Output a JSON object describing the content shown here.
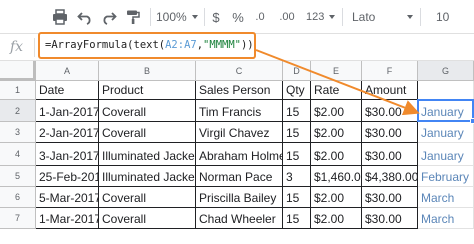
{
  "toolbar": {
    "zoom": "100%",
    "currency": "$",
    "percent": "%",
    "decimal_decrease": ".0",
    "decimal_increase": ".00",
    "more_formats": "123",
    "font": "Lato",
    "font_size": "10"
  },
  "formula_bar": {
    "fx": "fx",
    "prefix": "=ArrayFormula(text(",
    "range": "A2:A7",
    "comma": ",",
    "format": "\"MMMM\"",
    "suffix": "))"
  },
  "sheet": {
    "columns": [
      "A",
      "B",
      "C",
      "D",
      "E",
      "F",
      "G"
    ],
    "rows": [
      "1",
      "2",
      "3",
      "4",
      "5",
      "6",
      "7"
    ],
    "headers": [
      "Date",
      "Product",
      "Sales Person",
      "Qty",
      "Rate",
      "Amount"
    ],
    "data": [
      [
        "1-Jan-2017",
        "Coverall",
        "Tim Francis",
        "15",
        "$2.00",
        "$30.00",
        "January"
      ],
      [
        "2-Jan-2017",
        "Coverall",
        "Virgil Chavez",
        "15",
        "$2.00",
        "$30.00",
        "January"
      ],
      [
        "3-Jan-2017",
        "Illuminated Jacket",
        "Abraham Holmes",
        "15",
        "$2.00",
        "$30.00",
        "January"
      ],
      [
        "25-Feb-2017",
        "Illuminated Jacket",
        "Norman Pace",
        "3",
        "$1,460.00",
        "$4,380.00",
        "February"
      ],
      [
        "5-Mar-2017",
        "Coverall",
        "Priscilla Bailey",
        "15",
        "$2.00",
        "$30.00",
        "March"
      ],
      [
        "1-Mar-2017",
        "Coverall",
        "Chad Wheeler",
        "15",
        "$2.00",
        "$30.00",
        "March"
      ]
    ]
  },
  "colors": {
    "formula_highlight": "#f08a2c",
    "selection": "#4285f4",
    "result_text": "#5b86b8"
  }
}
